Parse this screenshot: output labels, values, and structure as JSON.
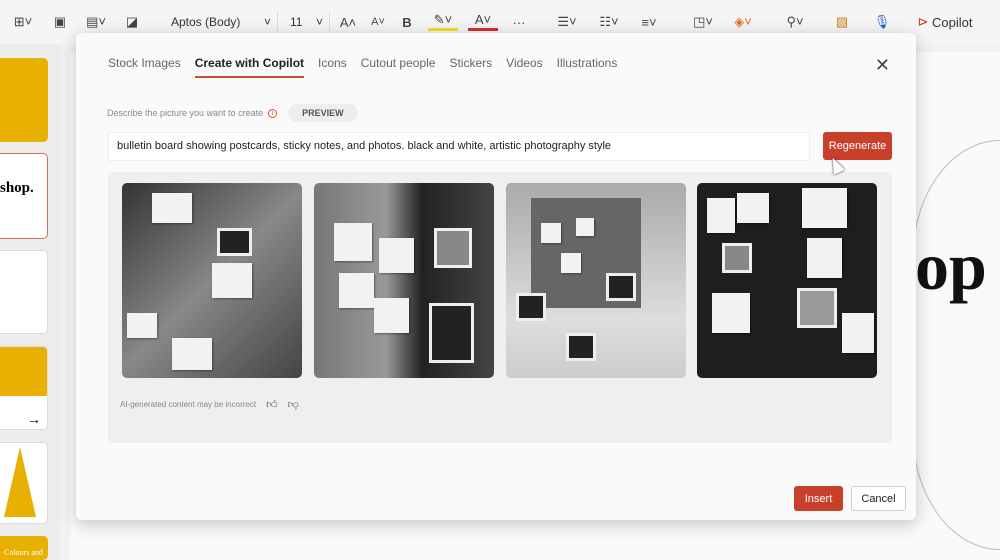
{
  "toolbar": {
    "font": "Aptos (Body)",
    "size": "11",
    "copilot": "Copilot",
    "more": "···"
  },
  "thumbnails": {
    "slide2_text": "shop.",
    "slide6_text": "Colours and"
  },
  "slide": {
    "title_fragment": "op"
  },
  "dialog": {
    "tabs": [
      "Stock Images",
      "Create with Copilot",
      "Icons",
      "Cutout people",
      "Stickers",
      "Videos",
      "Illustrations"
    ],
    "active_tab": "Create with Copilot",
    "describe_label": "Describe the picture you want to create",
    "preview_badge": "PREVIEW",
    "prompt": "bulletin board showing postcards, sticky notes, and photos. black and white, artistic photography style",
    "regenerate": "Regenerate",
    "ai_disclaimer": "AI-generated content may be incorrect",
    "insert": "Insert",
    "cancel": "Cancel"
  },
  "colors": {
    "accent": "#c8402a",
    "thumb_yellow": "#e8b000"
  }
}
